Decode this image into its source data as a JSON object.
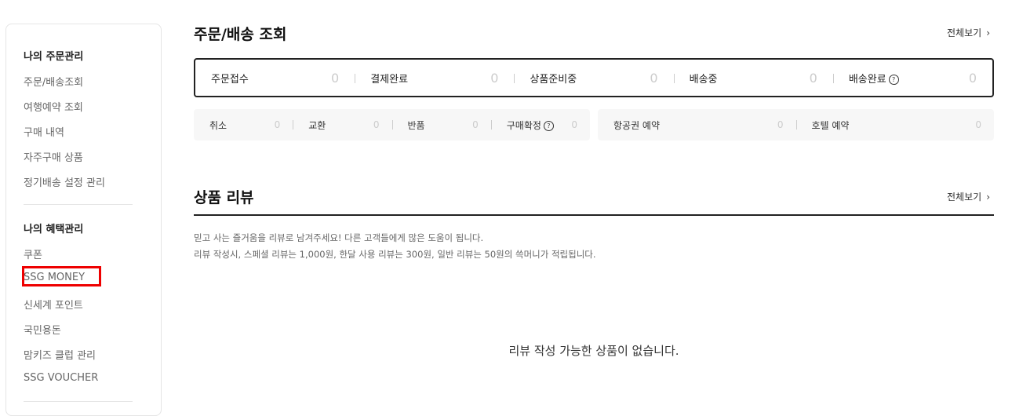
{
  "sidebar": {
    "groups": [
      {
        "title": "나의 주문관리",
        "items": [
          "주문/배송조회",
          "여행예약 조회",
          "구매 내역",
          "자주구매 상품",
          "정기배송 설정 관리"
        ]
      },
      {
        "title": "나의 혜택관리",
        "items": [
          "쿠폰",
          "SSG MONEY",
          "신세계 포인트",
          "국민용돈",
          "맘키즈 클럽 관리",
          "SSG VOUCHER"
        ]
      }
    ]
  },
  "order": {
    "title": "주문/배송 조회",
    "view_all": "전체보기",
    "status": [
      {
        "label": "주문접수",
        "count": "0"
      },
      {
        "label": "결제완료",
        "count": "0"
      },
      {
        "label": "상품준비중",
        "count": "0"
      },
      {
        "label": "배송중",
        "count": "0"
      },
      {
        "label": "배송완료",
        "count": "0",
        "help": "?"
      }
    ],
    "sub_left": [
      {
        "label": "취소",
        "count": "0"
      },
      {
        "label": "교환",
        "count": "0"
      },
      {
        "label": "반품",
        "count": "0"
      },
      {
        "label": "구매확정",
        "count": "0",
        "help": "?"
      }
    ],
    "sub_right": [
      {
        "label": "항공권 예약",
        "count": "0"
      },
      {
        "label": "호텔 예약",
        "count": "0"
      }
    ]
  },
  "review": {
    "title": "상품 리뷰",
    "view_all": "전체보기",
    "desc_line1": "믿고 사는 즐거움을 리뷰로 남겨주세요! 다른 고객들에게 많은 도움이 됩니다.",
    "desc_line2": "리뷰 작성시, 스페셜 리뷰는 1,000원, 한달 사용 리뷰는 300원, 일반 리뷰는 50원의 쓱머니가 적립됩니다.",
    "empty": "리뷰 작성 가능한 상품이 없습니다."
  },
  "icons": {
    "chevron": "chevron-right-icon",
    "help": "question-circle-icon"
  },
  "colors": {
    "highlight": "#ee0000",
    "border_strong": "#222222",
    "sub_bg": "#f7f7f7"
  }
}
